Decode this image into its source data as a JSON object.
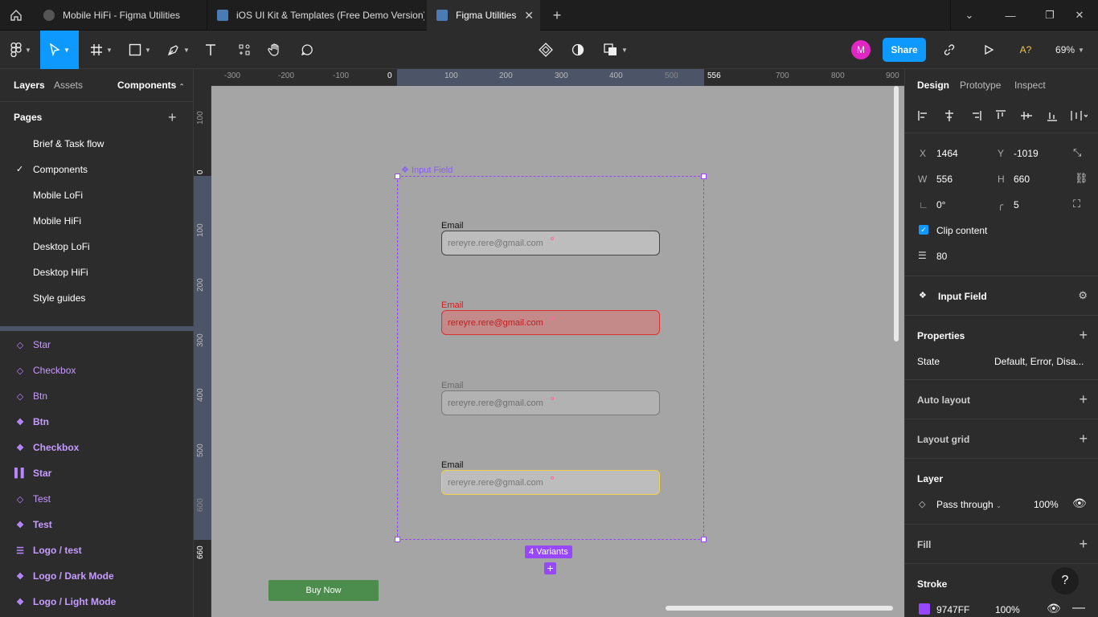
{
  "browser_tabs": [
    {
      "label": "Mobile HiFi - Figma Utilities",
      "active": false
    },
    {
      "label": "iOS UI Kit & Templates (Free Demo Version)",
      "active": false
    },
    {
      "label": "Figma Utilities",
      "active": true
    }
  ],
  "toolbar": {
    "avatar_initial": "M",
    "share_label": "Share",
    "zoom": "69%"
  },
  "left_panel": {
    "tabs": [
      "Layers",
      "Assets",
      "Components"
    ],
    "pages_title": "Pages",
    "pages": [
      "Brief & Task flow",
      "Components",
      "Mobile LoFi",
      "Mobile HiFi",
      "Desktop LoFi",
      "Desktop HiFi",
      "Style guides"
    ],
    "current_page": "Components",
    "layers": [
      {
        "label": "Star",
        "icon": "component-outline-icon",
        "bold": false
      },
      {
        "label": "Checkbox",
        "icon": "component-outline-icon",
        "bold": false
      },
      {
        "label": "Btn",
        "icon": "component-outline-icon",
        "bold": false
      },
      {
        "label": "Btn",
        "icon": "component-set-icon",
        "bold": true
      },
      {
        "label": "Checkbox",
        "icon": "component-set-icon",
        "bold": true
      },
      {
        "label": "Star",
        "icon": "vertical-auto-layout-icon",
        "bold": true
      },
      {
        "label": "Test",
        "icon": "component-outline-icon",
        "bold": false
      },
      {
        "label": "Test",
        "icon": "component-set-icon",
        "bold": true
      },
      {
        "label": "Logo / test",
        "icon": "text-lines-icon",
        "bold": true
      },
      {
        "label": "Logo / Dark Mode",
        "icon": "component-set-icon",
        "bold": true
      },
      {
        "label": "Logo / Light Mode",
        "icon": "component-set-icon",
        "bold": true
      }
    ]
  },
  "rulers": {
    "horizontal": [
      "-300",
      "-200",
      "-100",
      "0",
      "100",
      "200",
      "300",
      "400",
      "500",
      "556",
      "700",
      "800",
      "900"
    ],
    "vertical": [
      "100",
      "0",
      "100",
      "200",
      "300",
      "400",
      "500",
      "600",
      "660"
    ]
  },
  "canvas": {
    "component_label": "Input Field",
    "fields": [
      {
        "label": "Email",
        "value": "rereyre.rere@gmail.com",
        "state": "default"
      },
      {
        "label": "Email",
        "value": "rereyre.rere@gmail.com",
        "state": "error"
      },
      {
        "label": "Email",
        "value": "rereyre.rere@gmail.com",
        "state": "disabled"
      },
      {
        "label": "Email",
        "value": "rereyre.rere@gmail.com",
        "state": "focus"
      }
    ],
    "variants_badge": "4 Variants",
    "buy_now_label": "Buy Now"
  },
  "right_panel": {
    "tabs": [
      "Design",
      "Prototype",
      "Inspect"
    ],
    "x_label": "X",
    "x": "1464",
    "y_label": "Y",
    "y": "-1019",
    "w_label": "W",
    "w": "556",
    "h_label": "H",
    "h": "660",
    "rotation": "0°",
    "radius": "5",
    "clip_content_label": "Clip content",
    "spacing": "80",
    "component_name": "Input Field",
    "properties_title": "Properties",
    "state_label": "State",
    "state_value": "Default, Error, Disa...",
    "auto_layout_title": "Auto layout",
    "layout_grid_title": "Layout grid",
    "layer_title": "Layer",
    "blend_mode": "Pass through",
    "opacity": "100%",
    "fill_title": "Fill",
    "stroke_title": "Stroke",
    "stroke_color": "9747FF",
    "stroke_opacity": "100%",
    "help_label": "?"
  }
}
